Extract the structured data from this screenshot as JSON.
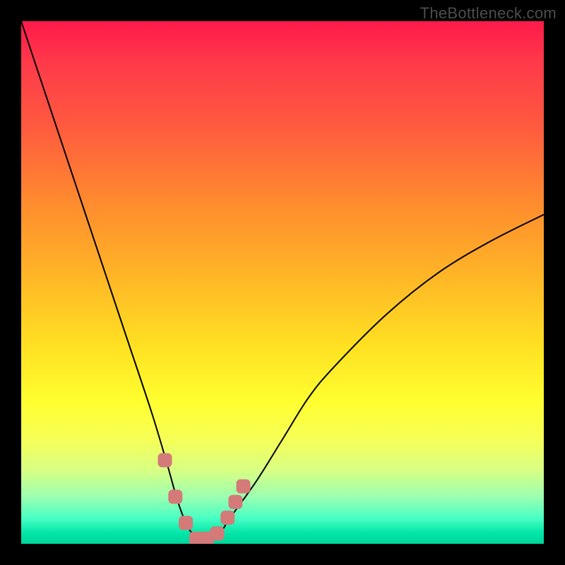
{
  "watermark": "TheBottleneck.com",
  "chart_data": {
    "type": "line",
    "title": "",
    "xlabel": "",
    "ylabel": "",
    "xlim": [
      0,
      100
    ],
    "ylim": [
      0,
      100
    ],
    "series": [
      {
        "name": "bottleneck-curve",
        "x": [
          0,
          5,
          10,
          15,
          20,
          25,
          28,
          30,
          32,
          34,
          36,
          38,
          40,
          45,
          50,
          55,
          60,
          70,
          80,
          90,
          100
        ],
        "values": [
          100,
          85,
          70,
          55,
          40,
          25,
          15,
          8,
          3,
          1,
          1,
          2,
          5,
          12,
          20,
          28,
          34,
          44,
          52,
          58,
          63
        ]
      }
    ],
    "markers": {
      "name": "highlight-points",
      "color": "#d47a78",
      "x": [
        27.5,
        29.5,
        31.5,
        33.5,
        35.5,
        37.5,
        39.5,
        41.0,
        42.5
      ],
      "values": [
        16,
        9,
        4,
        1,
        1,
        2,
        5,
        8,
        11
      ]
    },
    "gradient_stops": [
      {
        "pos": 0,
        "color": "#ff1a4a"
      },
      {
        "pos": 35,
        "color": "#ff8c2e"
      },
      {
        "pos": 73,
        "color": "#ffff30"
      },
      {
        "pos": 95,
        "color": "#4bffc4"
      },
      {
        "pos": 100,
        "color": "#00d49a"
      }
    ]
  }
}
